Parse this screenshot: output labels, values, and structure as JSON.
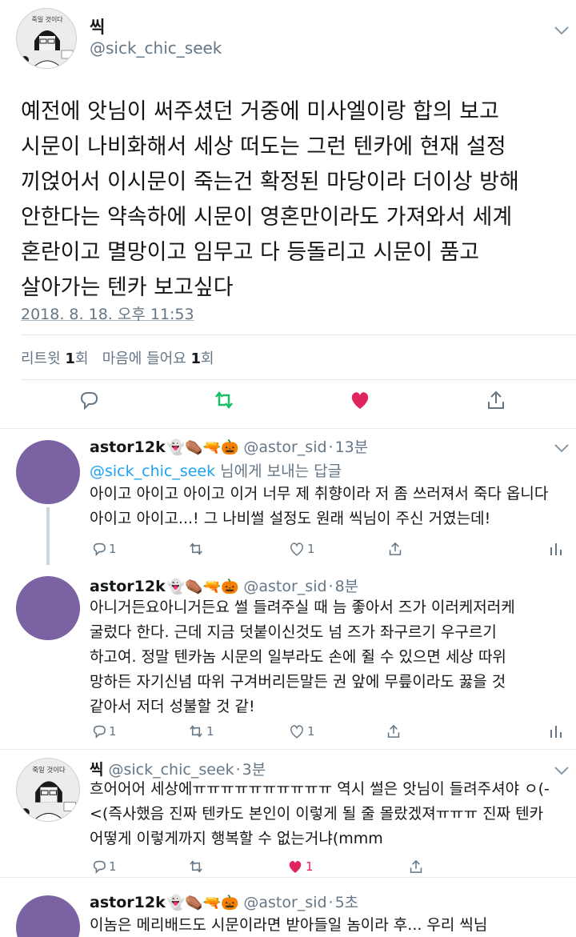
{
  "main_tweet": {
    "avatar_caption": "죽일 것이다",
    "name": "씩",
    "handle": "@sick_chic_seek",
    "text": "예전에 앗님이 써주셨던 거중에 미사엘이랑 합의 보고\n시문이 나비화해서 세상 떠도는 그런 텐카에 현재 설정\n끼얹어서 이시문이 죽는건 확정된 마당이라 더이상 방해\n안한다는 약속하에 시문이 영혼만이라도 가져와서 세계\n혼란이고 멸망이고 임무고 다 등돌리고 시문이 품고\n살아가는 텐카 보고싶다",
    "timestamp": "2018. 8. 18. 오후 11:53",
    "retweet_label": "리트윗",
    "retweet_count": "1",
    "retweet_unit": "회",
    "like_label": "마음에 들어요",
    "like_count": "1",
    "like_unit": "회",
    "colors": {
      "retweet": "#17bf63",
      "like": "#e0245e",
      "icon": "#657786"
    }
  },
  "replies": [
    {
      "name": "astor12k",
      "emojis": "👻⚰️🔫🎃",
      "handle": "@astor_sid",
      "time": "13분",
      "reply_to_handle": "@sick_chic_seek",
      "reply_to_suffix": " 님에게 보내는 답글",
      "text": "아이고 아이고 아이고 이거 너무 제 취향이라 저 좀 쓰러져서 죽다 옵니다\n아이고 아이고...! 그 나비썰 설정도 원래 씩님이 주신 거였는데!",
      "reply_count": "1",
      "retweet_count": "",
      "like_count": "1"
    },
    {
      "name": "astor12k",
      "emojis": "👻⚰️🔫🎃",
      "handle": "@astor_sid",
      "time": "8분",
      "text": "아니거든요아니거든요 썰 들려주실 때 늠 좋아서 즈가 이러케저러케\n굴렀다 한다. 근데 지금 덧붙이신것도 넘 즈가 좌구르기 우구르기\n하고여. 정말 텐카놈 시문의 일부라도 손에 쥘 수 있으면 세상 따위\n망하든 자기신념 따위 구겨버리든말든 권 앞에 무릎이라도 꿇을 것\n같아서 저더 성불할 것 같!",
      "reply_count": "1",
      "retweet_count": "1",
      "like_count": "1"
    },
    {
      "name": "씩",
      "handle": "@sick_chic_seek",
      "time": "3분",
      "text": "흐어어어 세상에ㅠㅠㅠㅠㅠㅠㅠㅠㅠㅠ 역시 썰은 앗님이 들려주셔야 ㅇ(-\n<(즉사했음 진짜 텐카도 본인이 이렇게 될 줄 몰랐겠져ㅠㅠㅠ 진짜 텐카\n어떻게 이렇게까지 행복할 수 없는거냐(mmm",
      "reply_count": "1",
      "retweet_count": "",
      "like_count": "1"
    },
    {
      "name": "astor12k",
      "emojis": "👻⚰️🔫🎃",
      "handle": "@astor_sid",
      "time": "5초",
      "text": "이놈은 메리배드도 시문이라면 받아들일 놈이라 후... 우리 씩님"
    }
  ]
}
